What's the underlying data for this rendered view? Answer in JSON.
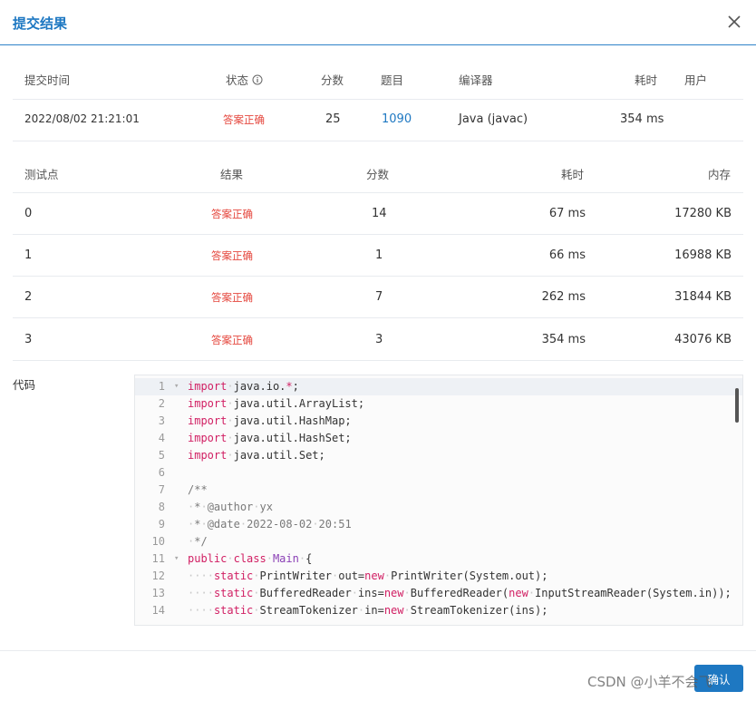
{
  "dialog": {
    "title": "提交结果",
    "confirm_label": "确认"
  },
  "submission": {
    "headers": {
      "time": "提交时间",
      "status": "状态",
      "score": "分数",
      "problem": "题目",
      "compiler": "编译器",
      "duration": "耗时",
      "user": "用户"
    },
    "row": {
      "time": "2022/08/02 21:21:01",
      "status": "答案正确",
      "score": "25",
      "problem": "1090",
      "compiler": "Java (javac)",
      "duration": "354 ms",
      "user": ""
    }
  },
  "tests": {
    "headers": {
      "case": "测试点",
      "result": "结果",
      "score": "分数",
      "time": "耗时",
      "memory": "内存"
    },
    "rows": [
      {
        "case": "0",
        "result": "答案正确",
        "score": "14",
        "time": "67 ms",
        "memory": "17280 KB"
      },
      {
        "case": "1",
        "result": "答案正确",
        "score": "1",
        "time": "66 ms",
        "memory": "16988 KB"
      },
      {
        "case": "2",
        "result": "答案正确",
        "score": "7",
        "time": "262 ms",
        "memory": "31844 KB"
      },
      {
        "case": "3",
        "result": "答案正确",
        "score": "3",
        "time": "354 ms",
        "memory": "43076 KB"
      }
    ]
  },
  "code": {
    "label": "代码",
    "lines": [
      {
        "n": "1",
        "text": "import·java.io.*;"
      },
      {
        "n": "2",
        "text": "import·java.util.ArrayList;"
      },
      {
        "n": "3",
        "text": "import·java.util.HashMap;"
      },
      {
        "n": "4",
        "text": "import·java.util.HashSet;"
      },
      {
        "n": "5",
        "text": "import·java.util.Set;"
      },
      {
        "n": "6",
        "text": ""
      },
      {
        "n": "7",
        "text": "/**"
      },
      {
        "n": "8",
        "text": "·*·@author·yx"
      },
      {
        "n": "9",
        "text": "·*·@date·2022-08-02·20:51"
      },
      {
        "n": "10",
        "text": "·*/"
      },
      {
        "n": "11",
        "text": "public·class·Main·{"
      },
      {
        "n": "12",
        "text": "····static·PrintWriter·out=new·PrintWriter(System.out);"
      },
      {
        "n": "13",
        "text": "····static·BufferedReader·ins=new·BufferedReader(new·InputStreamReader(System.in));"
      },
      {
        "n": "14",
        "text": "····static·StreamTokenizer·in=new·StreamTokenizer(ins);"
      }
    ]
  },
  "watermark": "CSDN @小羊不会飞",
  "colors": {
    "accent": "#1e78c2",
    "success_text": "#e5483f"
  },
  "icons": {
    "close": "close-icon",
    "info": "info-circle-icon"
  }
}
